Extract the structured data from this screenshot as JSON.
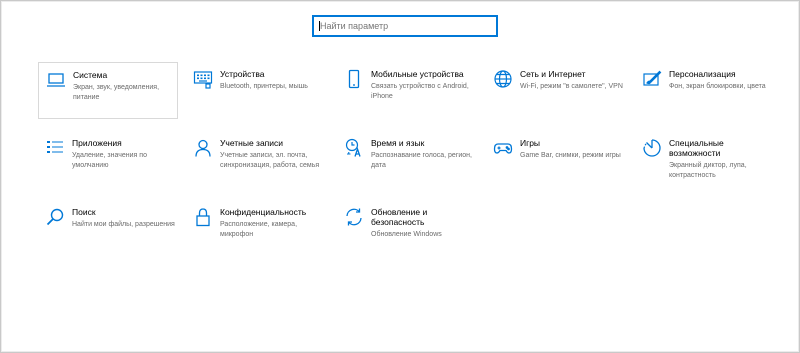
{
  "search": {
    "placeholder": "Найти параметр"
  },
  "colors": {
    "accent": "#0078d7",
    "text": "#000000",
    "secondary_text": "#6b6b6b"
  },
  "tiles": [
    {
      "title": "Система",
      "desc": "Экран, звук, уведомления, питание",
      "icon": "laptop-icon"
    },
    {
      "title": "Устройства",
      "desc": "Bluetooth, принтеры, мышь",
      "icon": "keyboard-icon"
    },
    {
      "title": "Мобильные устройства",
      "desc": "Связать устройство с Android, iPhone",
      "icon": "phone-icon"
    },
    {
      "title": "Сеть и Интернет",
      "desc": "Wi-Fi, режим \"в самолете\", VPN",
      "icon": "globe-icon"
    },
    {
      "title": "Персонализация",
      "desc": "Фон, экран блокировки, цвета",
      "icon": "paint-icon"
    },
    {
      "title": "Приложения",
      "desc": "Удаление, значения по умолчанию",
      "icon": "apps-list-icon"
    },
    {
      "title": "Учетные записи",
      "desc": "Учетные записи, эл. почта, синхронизация, работа, семья",
      "icon": "person-icon"
    },
    {
      "title": "Время и язык",
      "desc": "Распознавание голоса, регион, дата",
      "icon": "time-language-icon"
    },
    {
      "title": "Игры",
      "desc": "Game Bar, снимки, режим игры",
      "icon": "gamepad-icon"
    },
    {
      "title": "Специальные возможности",
      "desc": "Экранный диктор, лупа, контрастность",
      "icon": "accessibility-icon"
    },
    {
      "title": "Поиск",
      "desc": "Найти мои файлы, разрешения",
      "icon": "magnifier-icon"
    },
    {
      "title": "Конфиденциальность",
      "desc": "Расположение, камера, микрофон",
      "icon": "lock-icon"
    },
    {
      "title": "Обновление и безопасность",
      "desc": "Обновление Windows",
      "icon": "sync-icon"
    }
  ]
}
